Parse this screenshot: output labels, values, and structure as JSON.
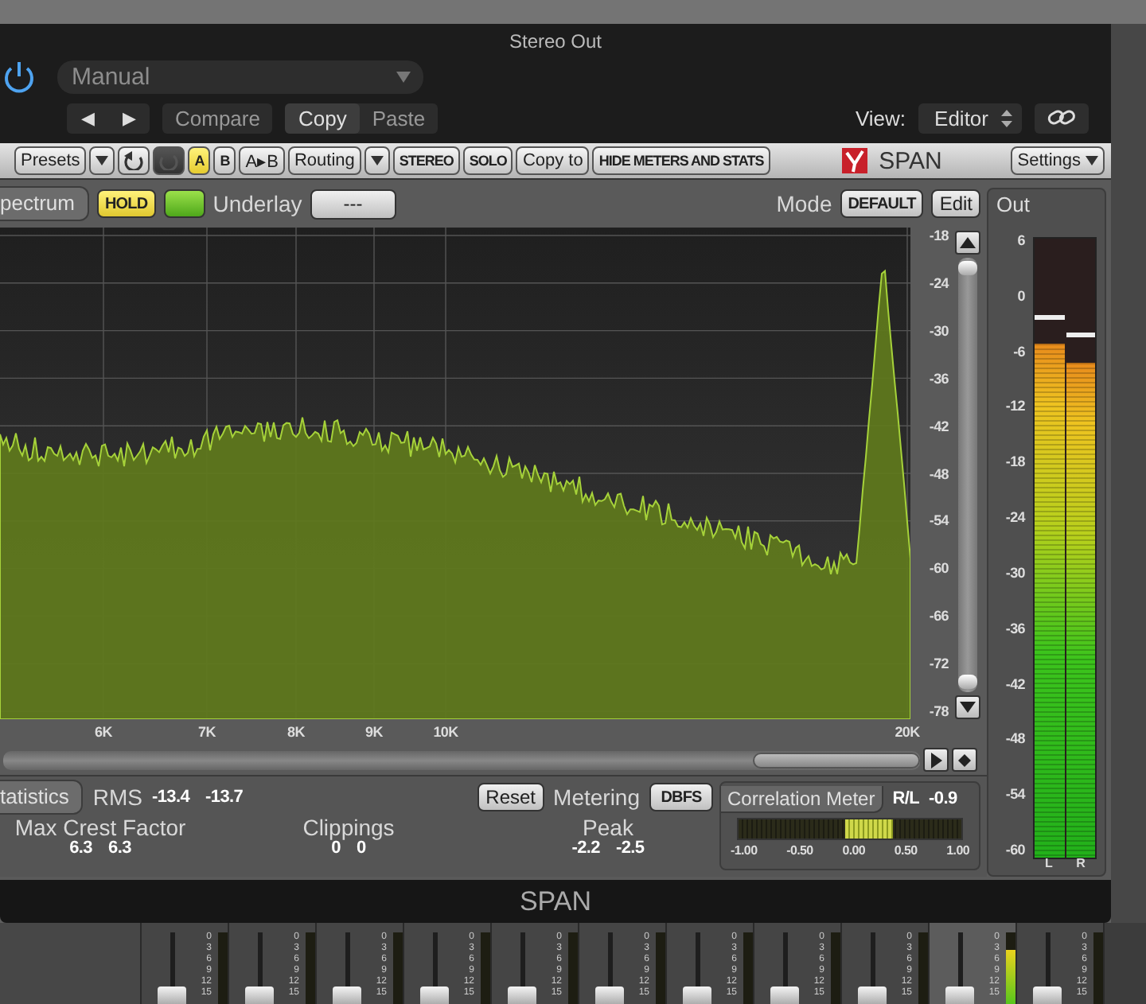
{
  "window": {
    "title": "Stereo Out"
  },
  "power": {
    "on": true
  },
  "header": {
    "preset": "Manual",
    "nav": [
      "◀",
      "▶"
    ],
    "compare": "Compare",
    "copy": "Copy",
    "paste": "Paste",
    "view_label": "View:",
    "view_value": "Editor"
  },
  "toolbar": {
    "items": [
      {
        "kind": "button",
        "label": "Presets"
      },
      {
        "kind": "caret"
      },
      {
        "kind": "undo"
      },
      {
        "kind": "redo"
      },
      {
        "kind": "ab",
        "label": "A",
        "selected": true
      },
      {
        "kind": "ab",
        "label": "B",
        "selected": false
      },
      {
        "kind": "button",
        "label": "A▸B"
      },
      {
        "kind": "button",
        "label": "Routing"
      },
      {
        "kind": "caret"
      },
      {
        "kind": "caps",
        "label": "STEREO"
      },
      {
        "kind": "caps",
        "label": "SOLO"
      },
      {
        "kind": "button",
        "label": "Copy to"
      },
      {
        "kind": "caps",
        "label": "HIDE METERS AND STATS"
      }
    ],
    "brand": "SPAN",
    "settings": "Settings"
  },
  "spectrum": {
    "tab": "pectrum",
    "hold": {
      "label": "HOLD",
      "on": true
    },
    "green_toggle": {
      "on": true
    },
    "underlay_label": "Underlay",
    "underlay_value": "---",
    "mode_label": "Mode",
    "mode_value": "DEFAULT",
    "edit": "Edit",
    "y_ticks": [
      "-18",
      "-24",
      "-30",
      "-36",
      "-42",
      "-48",
      "-54",
      "-60",
      "-66",
      "-72",
      "-78"
    ],
    "x_ticks": [
      "6K",
      "7K",
      "8K",
      "9K",
      "10K",
      "20K"
    ]
  },
  "meter": {
    "title": "Out",
    "scale": [
      "6",
      "0",
      "-6",
      "-12",
      "-18",
      "-24",
      "-30",
      "-36",
      "-42",
      "-48",
      "-54",
      "-60"
    ],
    "channels": [
      {
        "label": "L",
        "level": 0.83
      },
      {
        "label": "R",
        "level": 0.8
      }
    ]
  },
  "stats": {
    "tab": "tatistics",
    "rms_label": "RMS",
    "rms": [
      "-13.4",
      "-13.7"
    ],
    "reset": "Reset",
    "metering_label": "Metering",
    "metering_value": "DBFS",
    "groups": [
      {
        "label": "Max Crest Factor",
        "values": [
          "6.3",
          "6.3"
        ]
      },
      {
        "label": "Clippings",
        "values": [
          "0",
          "0"
        ]
      },
      {
        "label": "Peak",
        "values": [
          "-2.2",
          "-2.5"
        ]
      }
    ]
  },
  "correlation": {
    "title": "Correlation Meter",
    "reading_label": "R/L",
    "reading": "-0.9",
    "level": 0.585,
    "ticks": [
      "-1.00",
      "-0.50",
      "0.00",
      "0.50",
      "1.00"
    ]
  },
  "footer": {
    "title": "SPAN"
  },
  "mixer": {
    "strips": [
      {
        "scale": [
          "0",
          "3",
          "6",
          "9",
          "12",
          "15"
        ],
        "selected": false
      },
      {
        "scale": [
          "0",
          "3",
          "6",
          "9",
          "12",
          "15"
        ],
        "selected": false
      },
      {
        "scale": [
          "0",
          "3",
          "6",
          "9",
          "12",
          "15"
        ],
        "selected": false
      },
      {
        "scale": [
          "0",
          "3",
          "6",
          "9",
          "12",
          "15"
        ],
        "selected": false
      },
      {
        "scale": [
          "0",
          "3",
          "6",
          "9",
          "12",
          "15"
        ],
        "selected": false
      },
      {
        "scale": [
          "0",
          "3",
          "6",
          "9",
          "12",
          "15"
        ],
        "selected": false
      },
      {
        "scale": [
          "0",
          "3",
          "6",
          "9",
          "12",
          "15"
        ],
        "selected": false
      },
      {
        "scale": [
          "0",
          "3",
          "6",
          "9",
          "12",
          "15"
        ],
        "selected": false
      },
      {
        "scale": [
          "0",
          "3",
          "6",
          "9",
          "12",
          "15"
        ],
        "selected": false
      },
      {
        "scale": [
          "0",
          "3",
          "6",
          "9",
          "12",
          "15"
        ],
        "selected": true
      },
      {
        "scale": [
          "0",
          "3",
          "6",
          "9",
          "12",
          "15"
        ],
        "selected": false
      }
    ]
  }
}
